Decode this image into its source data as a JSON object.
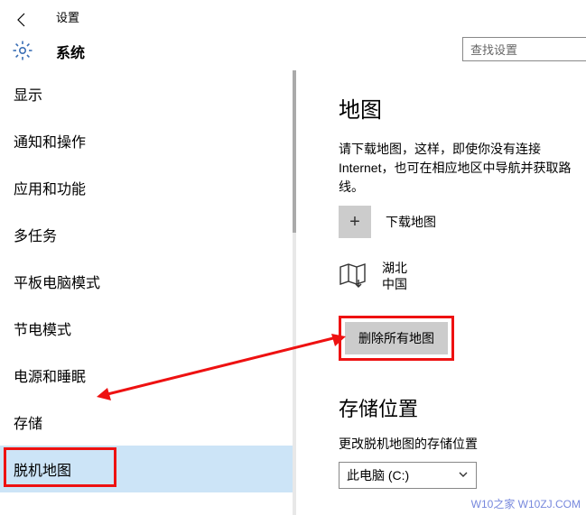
{
  "header": {
    "settings": "设置",
    "system": "系统",
    "search_placeholder": "查找设置"
  },
  "sidebar": {
    "items": [
      {
        "label": "显示"
      },
      {
        "label": "通知和操作"
      },
      {
        "label": "应用和功能"
      },
      {
        "label": "多任务"
      },
      {
        "label": "平板电脑模式"
      },
      {
        "label": "节电模式"
      },
      {
        "label": "电源和睡眠"
      },
      {
        "label": "存储"
      },
      {
        "label": "脱机地图"
      }
    ]
  },
  "content": {
    "title": "地图",
    "desc": "请下载地图，这样，即使你没有连接 Internet，也可在相应地区中导航并获取路线。",
    "download_label": "下载地图",
    "map_region1": "湖北",
    "map_region2": "中国",
    "delete_all": "删除所有地图",
    "storage_title": "存储位置",
    "storage_desc": "更改脱机地图的存储位置",
    "dropdown_value": "此电脑 (C:)"
  },
  "watermark": "W10之家 W10ZJ.COM"
}
